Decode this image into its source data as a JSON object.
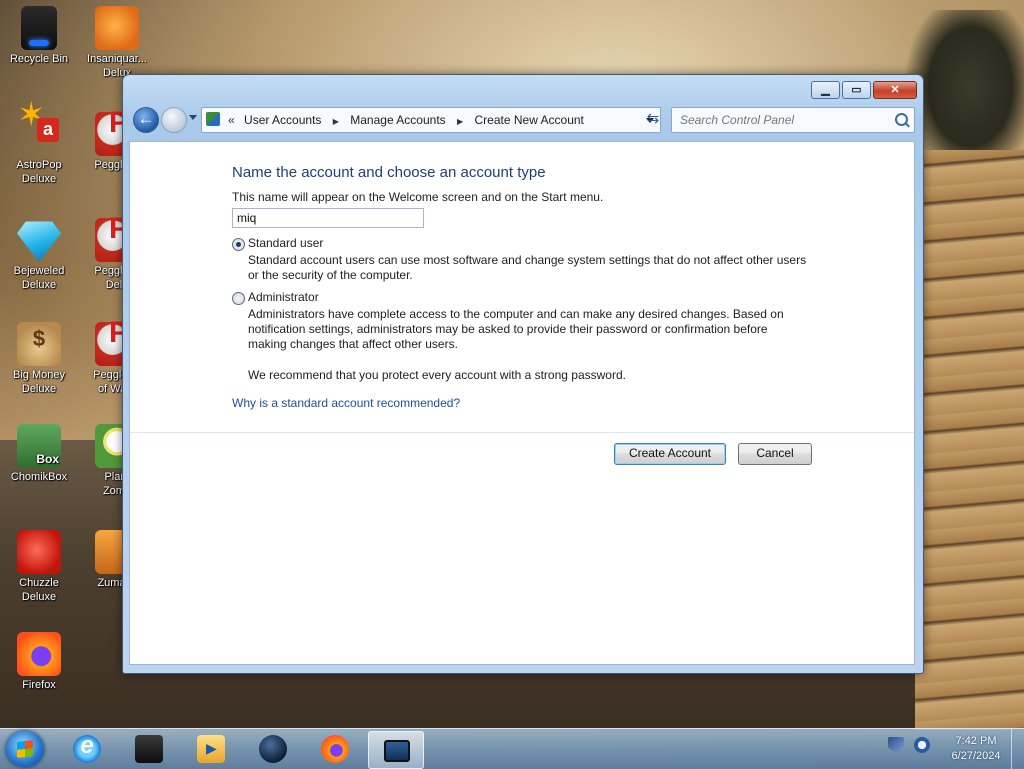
{
  "desktop": {
    "icons": [
      {
        "label": "Recycle Bin",
        "icon": "recycle-bin-icon"
      },
      {
        "label": "Insaniquar...\nDelux",
        "icon": "fish-game-icon"
      },
      {
        "label": "AstroPop\nDeluxe",
        "icon": "astropop-icon"
      },
      {
        "label": "Peggle D",
        "icon": "peggle-icon"
      },
      {
        "label": "Bejeweled\nDeluxe",
        "icon": "gem-icon"
      },
      {
        "label": "Peggle N\nDelu",
        "icon": "peggle-nights-icon"
      },
      {
        "label": "Big Money\nDeluxe",
        "icon": "money-bag-icon"
      },
      {
        "label": "Peggle W\nof Ward",
        "icon": "peggle-world-icon"
      },
      {
        "label": "ChomikBox",
        "icon": "chomikbox-icon"
      },
      {
        "label": "Plant\nZomb",
        "icon": "plants-zombies-icon"
      },
      {
        "label": "Chuzzle\nDeluxe",
        "icon": "chuzzle-icon"
      },
      {
        "label": "Zuma D",
        "icon": "zuma-icon"
      },
      {
        "label": "Firefox",
        "icon": "firefox-icon"
      }
    ]
  },
  "window": {
    "controls": {
      "minimize": "▁",
      "maximize": "▭",
      "close": "✕"
    },
    "address": {
      "lead": "«",
      "crumbs": [
        "User Accounts",
        "Manage Accounts",
        "Create New Account"
      ],
      "separator": "▶"
    },
    "refresh_glyph": "⇆",
    "search_placeholder": "Search Control Panel"
  },
  "form": {
    "heading": "Name the account and choose an account type",
    "subtext": "This name will appear on the Welcome screen and on the Start menu.",
    "name_value": "miq",
    "options": {
      "standard": {
        "label": "Standard user",
        "checked": true,
        "desc": "Standard account users can use most software and change system settings that do not affect other users or the security of the computer."
      },
      "admin": {
        "label": "Administrator",
        "checked": false,
        "desc": "Administrators have complete access to the computer and can make any desired changes. Based on notification settings, administrators may be asked to provide their password or confirmation before making changes that affect other users."
      }
    },
    "recommend": "We recommend that you protect every account with a strong password.",
    "link": "Why is a standard account recommended?",
    "buttons": {
      "create": "Create Account",
      "cancel": "Cancel"
    }
  },
  "taskbar": {
    "items": [
      "internet-explorer-icon",
      "command-prompt-icon",
      "media-player-icon",
      "globe-app-icon",
      "firefox-icon",
      "control-panel-icon"
    ],
    "active_item": "control-panel-icon",
    "clock": {
      "time": "7:42 PM",
      "date": "6/27/2024"
    }
  }
}
